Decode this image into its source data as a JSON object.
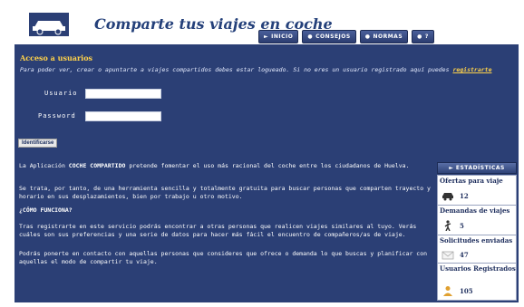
{
  "header": {
    "title": "Comparte tus viajes en coche",
    "nav": [
      {
        "label": "INICIO"
      },
      {
        "label": "CONSEJOS"
      },
      {
        "label": "NORMAS"
      },
      {
        "label": "?"
      }
    ]
  },
  "login": {
    "title": "Acceso a usuarios",
    "message": "Para poder ver, crear o apuntarte a viajes compartidos debes estar logueado. Si no eres un usuario registrado aquí puedes",
    "register_link": "registrarte",
    "username_label": "Usuario",
    "username_value": "",
    "password_label": "Password",
    "password_value": "",
    "submit_label": "Identificarse"
  },
  "info": {
    "p1_before": "La Aplicación",
    "p1_strong": "COCHE COMPARTIDO",
    "p1_after": "pretende fomentar el uso más racional del coche entre los ciudadanos de Huelva.",
    "p2": "Se trata, por tanto, de una herramienta sencilla y totalmente gratuita para buscar personas que comparten trayecto y horario en sus desplazamientos, bien por trabajo u otro motivo.",
    "heading": "¿CÓMO FUNCIONA?",
    "p3": "Tras registrarte en este servicio podrás encontrar a otras personas que realicen viajes similares al tuyo. Verás cuáles son sus preferencias y una serie de datos para hacer más fácil el encuentro de compañeros/as de viaje.",
    "p4": "Podrás ponerte en contacto con aquellas personas que consideres que ofrece o demanda lo que buscas y planificar con aquellas el modo de compartir tu viaje."
  },
  "stats": {
    "header": "ESTADÍSTICAS",
    "items": [
      {
        "title": "Ofertas para viaje",
        "value": "12",
        "icon": "car-icon"
      },
      {
        "title": "Demandas de viajes",
        "value": "5",
        "icon": "hitchhiker-icon"
      },
      {
        "title": "Solicitudes enviadas",
        "value": "47",
        "icon": "envelope-icon"
      },
      {
        "title": "Usuarios Registrados",
        "value": "105",
        "icon": "users-icon"
      }
    ]
  },
  "colors": {
    "panel": "#2b3f75",
    "accent": "#ffd24a",
    "title": "#24407a"
  }
}
